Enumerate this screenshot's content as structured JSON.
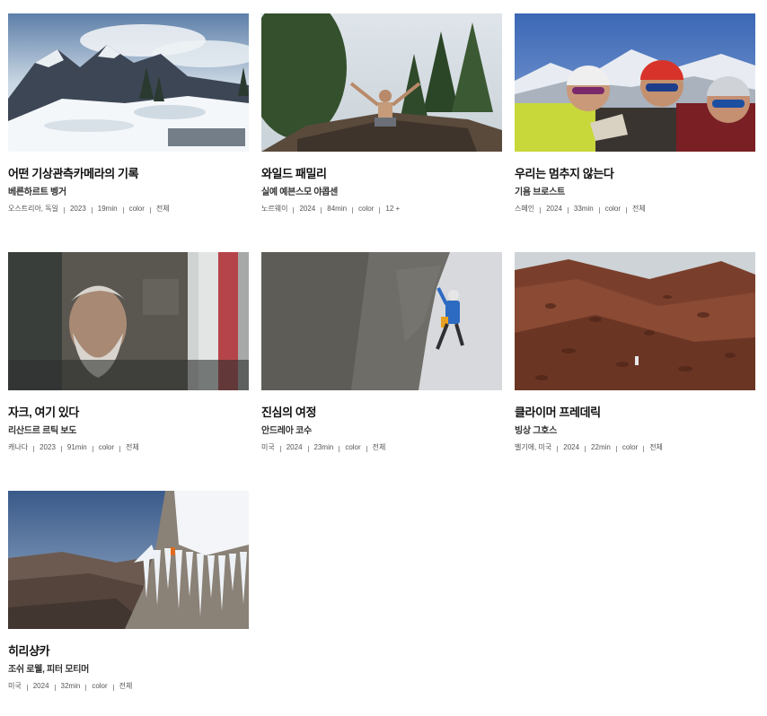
{
  "films": [
    {
      "title": "어떤 기상관측카메라의 기록",
      "director": "베른하르트 벵거",
      "meta": [
        "오스트리아, 독일",
        "2023",
        "19min",
        "color",
        "전체"
      ],
      "image": "snowy-mountain-valley"
    },
    {
      "title": "와일드 패밀리",
      "director": "실예 예븐스모 야콥센",
      "meta": [
        "노르웨이",
        "2024",
        "84min",
        "color",
        "12 +"
      ],
      "image": "child-on-rooftop"
    },
    {
      "title": "우리는 멈추지 않는다",
      "director": "기욤 브로스트",
      "meta": [
        "스페인",
        "2024",
        "33min",
        "color",
        "전체"
      ],
      "image": "climbers-selfie"
    },
    {
      "title": "자크, 여기 있다",
      "director": "리산드르 르틱 보도",
      "meta": [
        "캐나다",
        "2023",
        "91min",
        "color",
        "전체"
      ],
      "image": "old-man-portrait"
    },
    {
      "title": "진심의 여정",
      "director": "안드레아 코수",
      "meta": [
        "미국",
        "2024",
        "23min",
        "color",
        "전체"
      ],
      "image": "climber-on-rock-face"
    },
    {
      "title": "클라이머 프레데릭",
      "director": "빙상 그호스",
      "meta": [
        "벨기에, 미국",
        "2024",
        "22min",
        "color",
        "전체"
      ],
      "image": "red-rock-wall"
    },
    {
      "title": "히리샹카",
      "director": "조쉬 로웰, 피터 모티머",
      "meta": [
        "미국",
        "2024",
        "32min",
        "color",
        "전체"
      ],
      "image": "icicle-climber"
    }
  ]
}
